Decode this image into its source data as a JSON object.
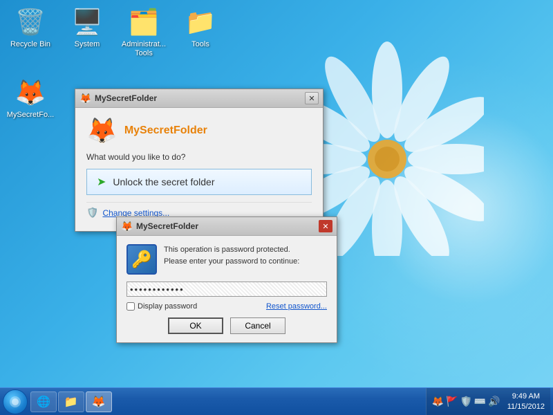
{
  "desktop": {
    "icons_top": [
      {
        "id": "recycle-bin",
        "label": "Recycle Bin",
        "icon": "🗑️"
      },
      {
        "id": "system",
        "label": "System",
        "icon": "🖥️"
      },
      {
        "id": "admin-tools",
        "label": "Administrat...\nTools",
        "icon": "🗂️"
      },
      {
        "id": "tools",
        "label": "Tools",
        "icon": "📁"
      }
    ],
    "icons_left": [
      {
        "id": "mysecretfolder",
        "label": "MySecretFo...",
        "icon": "🦊"
      }
    ]
  },
  "dialog_main": {
    "title": "MySecretFolder",
    "close_label": "✕",
    "app_title": "MySecretFolder",
    "subtitle": "What would you like to do?",
    "unlock_label": "Unlock the secret folder",
    "change_settings_label": "Change settings..."
  },
  "dialog_password": {
    "title": "MySecretFolder",
    "close_label": "✕",
    "description_line1": "This operation is password protected.",
    "description_line2": "Please enter your password to continue:",
    "password_dots": "●●●●●●●●●●●●",
    "display_password_label": "Display password",
    "reset_password_label": "Reset password...",
    "ok_label": "OK",
    "cancel_label": "Cancel"
  },
  "taskbar": {
    "items": [
      {
        "id": "ie",
        "label": "",
        "icon": "🌐"
      },
      {
        "id": "explorer",
        "label": "",
        "icon": "📁"
      },
      {
        "id": "mysecretfolder",
        "label": "",
        "icon": "🦊"
      }
    ],
    "clock_time": "9:49 AM",
    "clock_date": "11/15/2012",
    "tray_icons": [
      "🦊",
      "🚩",
      "🛡️",
      "⌨️",
      "🔊"
    ]
  }
}
